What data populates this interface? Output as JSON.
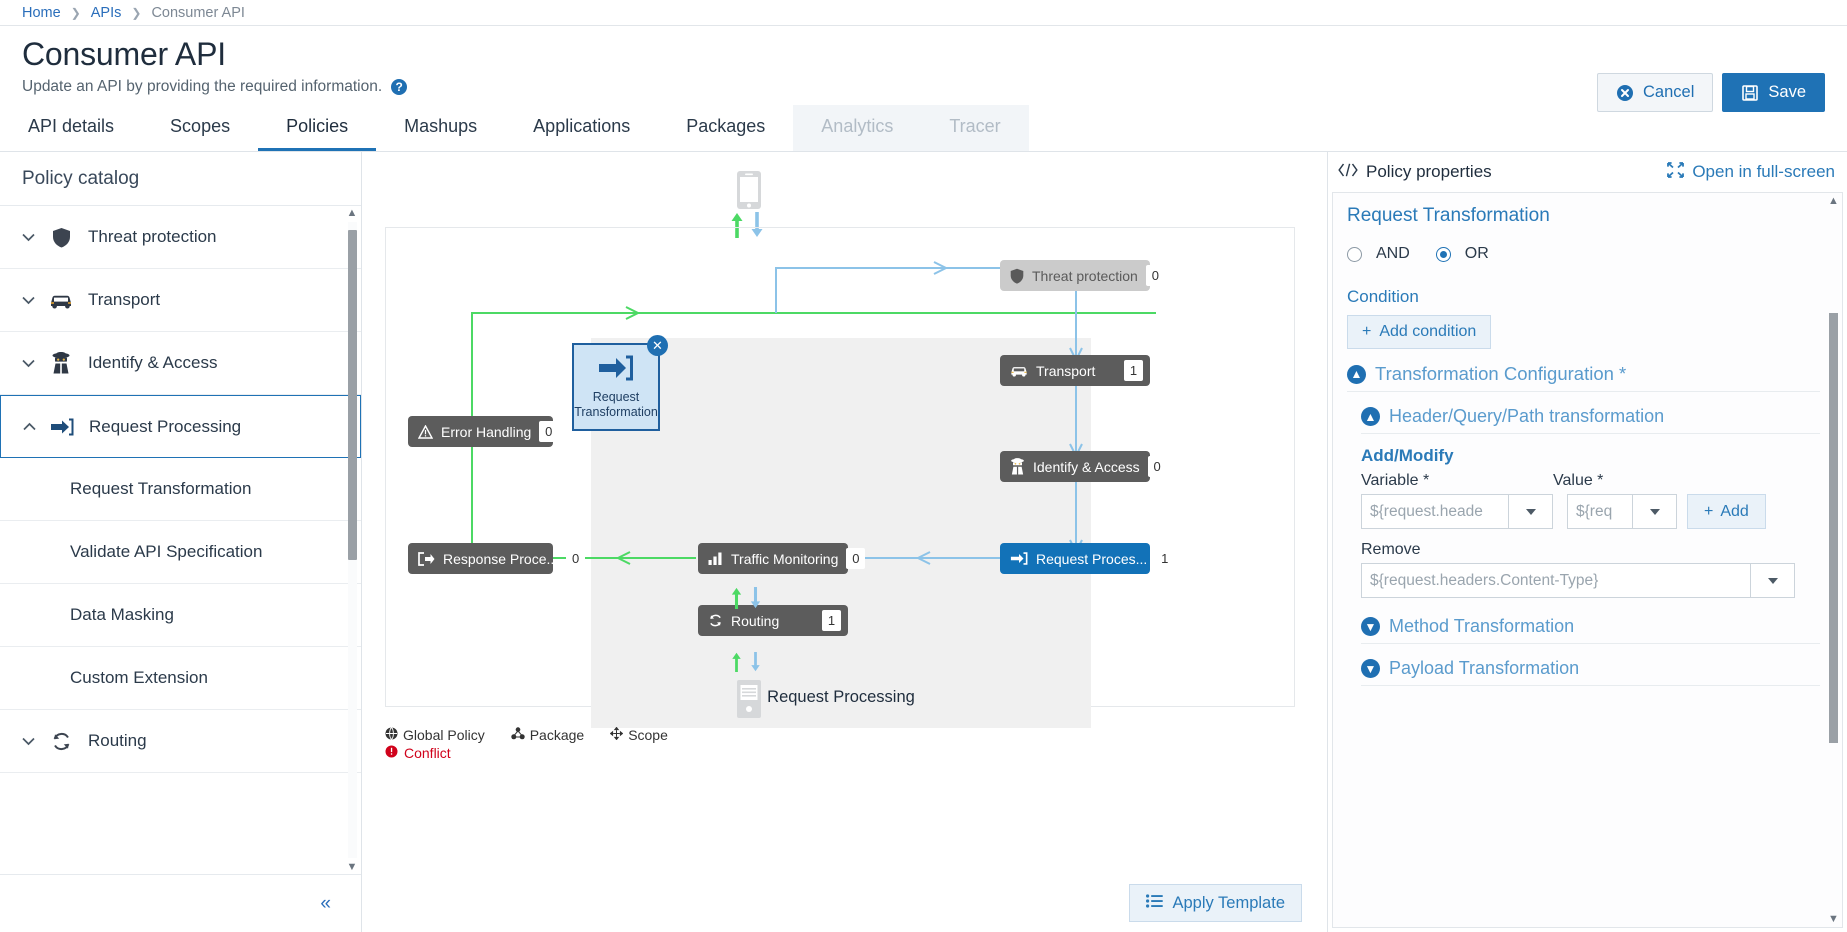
{
  "breadcrumb": {
    "items": [
      "Home",
      "APIs",
      "Consumer API"
    ],
    "separator": "❯"
  },
  "header": {
    "title": "Consumer API",
    "subtitle": "Update an API by providing the required information.",
    "help_glyph": "?",
    "cancel_label": "Cancel",
    "save_label": "Save",
    "cancel_icon": "circle-x-icon",
    "save_icon": "floppy-disk-icon"
  },
  "tabs": [
    {
      "label": "API details",
      "state": "normal"
    },
    {
      "label": "Scopes",
      "state": "normal"
    },
    {
      "label": "Policies",
      "state": "active"
    },
    {
      "label": "Mashups",
      "state": "normal"
    },
    {
      "label": "Applications",
      "state": "normal"
    },
    {
      "label": "Packages",
      "state": "normal"
    },
    {
      "label": "Analytics",
      "state": "disabled"
    },
    {
      "label": "Tracer",
      "state": "disabled"
    }
  ],
  "catalog": {
    "heading": "Policy catalog",
    "groups": [
      {
        "label": "Threat protection",
        "icon": "shield-icon",
        "expanded": false
      },
      {
        "label": "Transport",
        "icon": "car-icon",
        "expanded": false
      },
      {
        "label": "Identify & Access",
        "icon": "spy-icon",
        "expanded": false
      },
      {
        "label": "Request Processing",
        "icon": "arrow-into-bracket-icon",
        "expanded": true,
        "selected": true
      },
      {
        "label": "Routing",
        "icon": "refresh-icon",
        "expanded": false
      }
    ],
    "children": [
      "Request Transformation",
      "Validate API Specification",
      "Data Masking",
      "Custom Extension"
    ],
    "collapse_glyph": "«",
    "chevron_down": "∨",
    "chevron_up": "∧"
  },
  "canvas": {
    "zone_label": "Request Processing",
    "apply_template_label": "Apply Template",
    "apply_template_icon": "list-icon",
    "selected_card": {
      "label_line1": "Request",
      "label_line2": "Transformation",
      "icon": "arrow-into-bracket-icon",
      "close_glyph": "✕"
    },
    "legend": [
      {
        "label": "Global Policy",
        "icon": "globe-icon",
        "color": "#333333"
      },
      {
        "label": "Package",
        "icon": "package-icon",
        "color": "#333333"
      },
      {
        "label": "Scope",
        "icon": "move-icon",
        "color": "#333333"
      },
      {
        "label": "Conflict",
        "icon": "exclamation-circle-icon",
        "color": "#d0021b"
      }
    ],
    "stages_left": [
      {
        "label": "Error Handling",
        "count": "0",
        "icon": "warning-icon",
        "style": "dark"
      },
      {
        "label": "Response Proce...",
        "count": "0",
        "icon": "arrow-out-icon",
        "style": "dark"
      }
    ],
    "stages_center": [
      {
        "label": "Traffic Monitoring",
        "count": "0",
        "icon": "bar-chart-icon",
        "style": "dark"
      },
      {
        "label": "Routing",
        "count": "1",
        "icon": "refresh-icon",
        "style": "dark"
      }
    ],
    "stages_right": [
      {
        "label": "Threat protection",
        "count": "0",
        "icon": "shield-icon",
        "style": "light"
      },
      {
        "label": "Transport",
        "count": "1",
        "icon": "car-icon",
        "style": "dark"
      },
      {
        "label": "Identify & Access",
        "count": "0",
        "icon": "spy-icon",
        "style": "dark"
      },
      {
        "label": "Request Proces...",
        "count": "1",
        "icon": "arrow-into-bracket-icon",
        "style": "blue"
      }
    ],
    "colors": {
      "request_flow": "#4cd964",
      "response_flow": "#8cc3e8",
      "zone_bg": "#f0f0f0"
    }
  },
  "properties": {
    "panel_title": "Policy properties",
    "panel_icon": "code-brackets-icon",
    "fullscreen_label": "Open in full-screen",
    "fullscreen_icon": "expand-arrows-icon",
    "policy_title": "Request Transformation",
    "operator": {
      "and_label": "AND",
      "or_label": "OR",
      "selected": "OR"
    },
    "condition_label": "Condition",
    "add_condition_label": "Add condition",
    "add_condition_icon": "plus-icon",
    "sections": [
      {
        "label": "Transformation Configuration *",
        "expanded": true,
        "level": 0
      },
      {
        "label": "Header/Query/Path transformation",
        "expanded": true,
        "level": 1
      },
      {
        "label": "Method Transformation",
        "expanded": false,
        "level": 1
      },
      {
        "label": "Payload Transformation",
        "expanded": false,
        "level": 1
      }
    ],
    "add_modify": {
      "title": "Add/Modify",
      "variable_label": "Variable *",
      "value_label": "Value *",
      "variable_placeholder": "${request.headers.Content-Type}",
      "value_placeholder": "${request.headers.Accept}",
      "variable_visible": "${request.heade",
      "value_visible": "${req",
      "add_label": "Add",
      "add_icon": "plus-icon"
    },
    "remove": {
      "label": "Remove",
      "placeholder": "${request.headers.Content-Type}"
    }
  },
  "colors": {
    "accent": "#1f72b5",
    "link": "#2a7ab8",
    "danger": "#d0021b",
    "chip_dark": "#5c5c5c"
  }
}
